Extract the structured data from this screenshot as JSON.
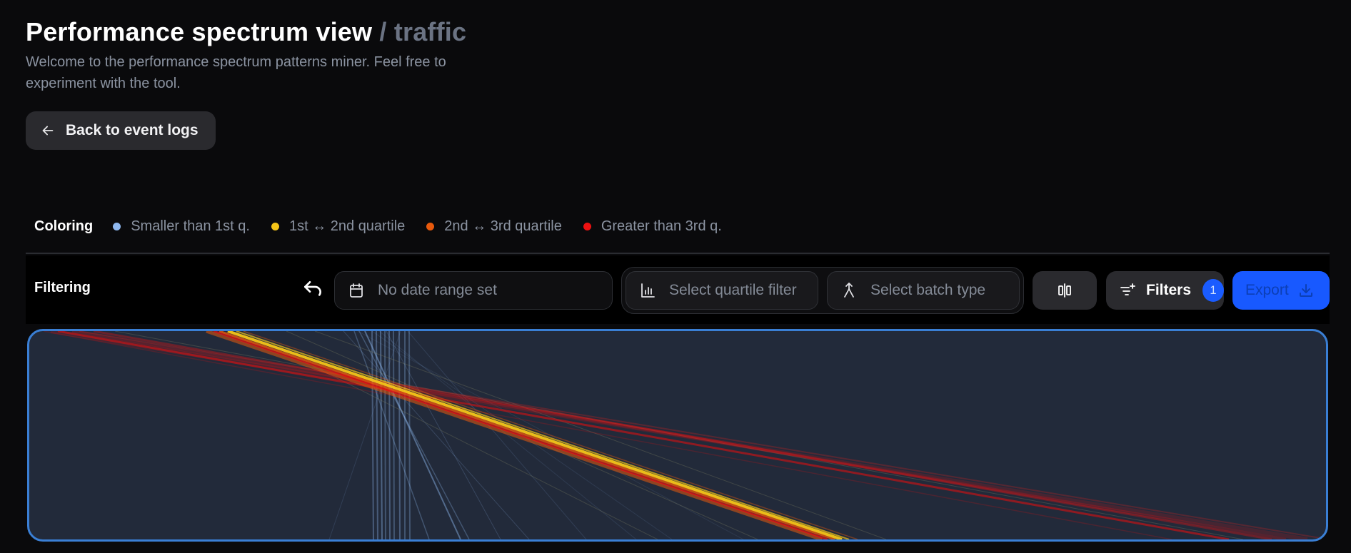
{
  "header": {
    "title": "Performance spectrum view",
    "separator": "/",
    "subtitle": "traffic",
    "description": "Welcome to the performance spectrum patterns miner. Feel free to experiment with the tool."
  },
  "back_button": {
    "label": "Back to event logs",
    "icon": "arrow-left-icon"
  },
  "coloring": {
    "label": "Coloring",
    "items": [
      {
        "label": "Smaller than 1st q.",
        "color": "#8fb8f0"
      },
      {
        "label": "1st ↔ 2nd quartile",
        "color": "#f5c518"
      },
      {
        "label": "2nd ↔ 3rd quartile",
        "color": "#e8590c"
      },
      {
        "label": "Greater than 3rd q.",
        "color": "#ee1111"
      }
    ]
  },
  "filtering": {
    "label": "Filtering",
    "undo_icon": "undo-icon",
    "date_range": {
      "placeholder": "No date range set",
      "icon": "calendar-icon"
    },
    "quartile_filter": {
      "placeholder": "Select quartile filter",
      "icon": "bar-chart-icon"
    },
    "batch_type": {
      "placeholder": "Select batch type",
      "icon": "merge-icon"
    },
    "align_icon": "align-columns-icon",
    "filters": {
      "label": "Filters",
      "count": "1",
      "icon": "filter-plus-icon"
    },
    "export": {
      "label": "Export",
      "icon": "download-icon"
    }
  },
  "colors": {
    "background": "#0a0a0c",
    "panel": "#222a3a",
    "accent": "#1859ff",
    "border_accent": "#3a7fd5"
  }
}
